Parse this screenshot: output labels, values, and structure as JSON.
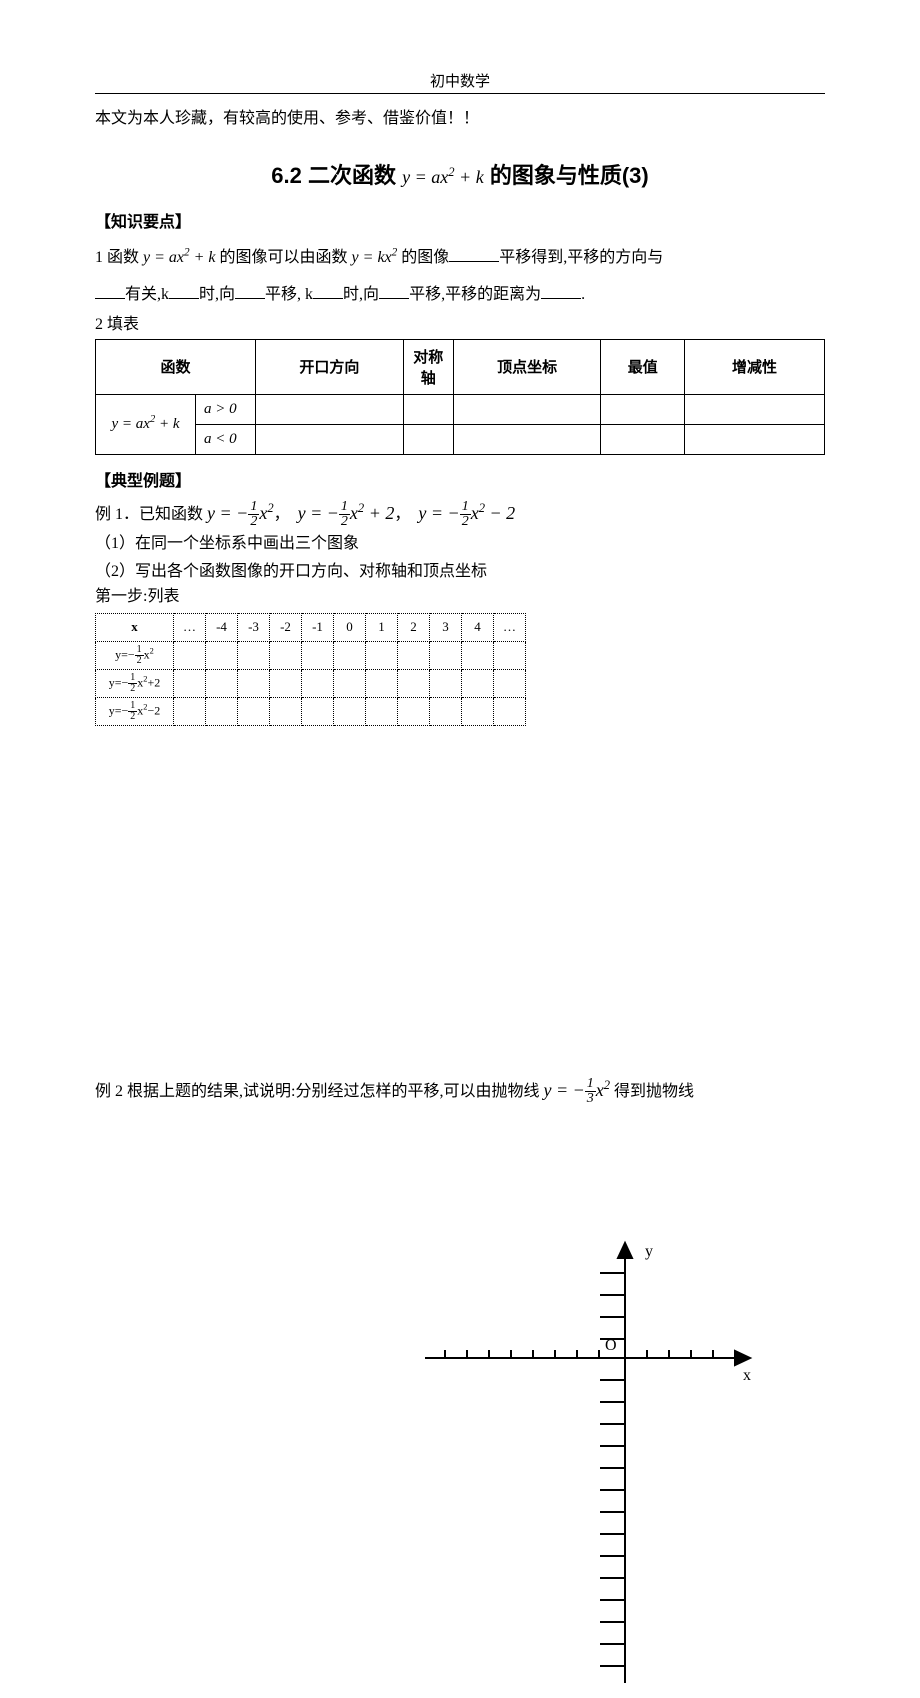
{
  "header": "初中数学",
  "intro": "本文为本人珍藏，有较高的使用、参考、借鉴价值！！",
  "title_prefix": "6.2 二次函数",
  "title_formula": "y = ax² + k",
  "title_suffix": "的图象与性质(3)",
  "section1": "【知识要点】",
  "p1_a": "1 函数 ",
  "p1_formula1": "y = ax² + k",
  "p1_b": " 的图像可以由函数 ",
  "p1_formula2": "y = kx²",
  "p1_c": " 的图像",
  "p1_d": "平移得到,平移的方向与",
  "p2_a": "有关,k",
  "p2_b": "时,向",
  "p2_c": "平移, k",
  "p2_d": "时,向",
  "p2_e": "平移,平移的距离为",
  "p3": "2 填表",
  "table1": {
    "headers": [
      "函数",
      "开口方向",
      "对称轴",
      "顶点坐标",
      "最值",
      "增减性"
    ],
    "row_func": "y = ax² + k",
    "cond1": "a > 0",
    "cond2": "a < 0"
  },
  "section2": "【典型例题】",
  "ex1_label": "例 1．已知函数 ",
  "ex1_f1": "y = −½x²",
  "ex1_f2": "y = −½x² + 2",
  "ex1_f3": "y = −½x² − 2",
  "ex1_q1": "（1）在同一个坐标系中画出三个图象",
  "ex1_q2": "（2）写出各个函数图像的开口方向、对称轴和顶点坐标",
  "step1": "第一步:列表",
  "table2": {
    "x_header": "x",
    "x_values": [
      "…",
      "-4",
      "-3",
      "-2",
      "-1",
      "0",
      "1",
      "2",
      "3",
      "4",
      "…"
    ],
    "rows": [
      "y=-½x²",
      "y=-½x²+2",
      "y=-½x²-2"
    ]
  },
  "axis_y": "y",
  "axis_x": "x",
  "origin": "O",
  "ex2_a": "例 2 根据上题的结果,试说明:分别经过怎样的平移,可以由抛物线 ",
  "ex2_f": "y = −⅓x²",
  "ex2_b": " 得到抛物线"
}
